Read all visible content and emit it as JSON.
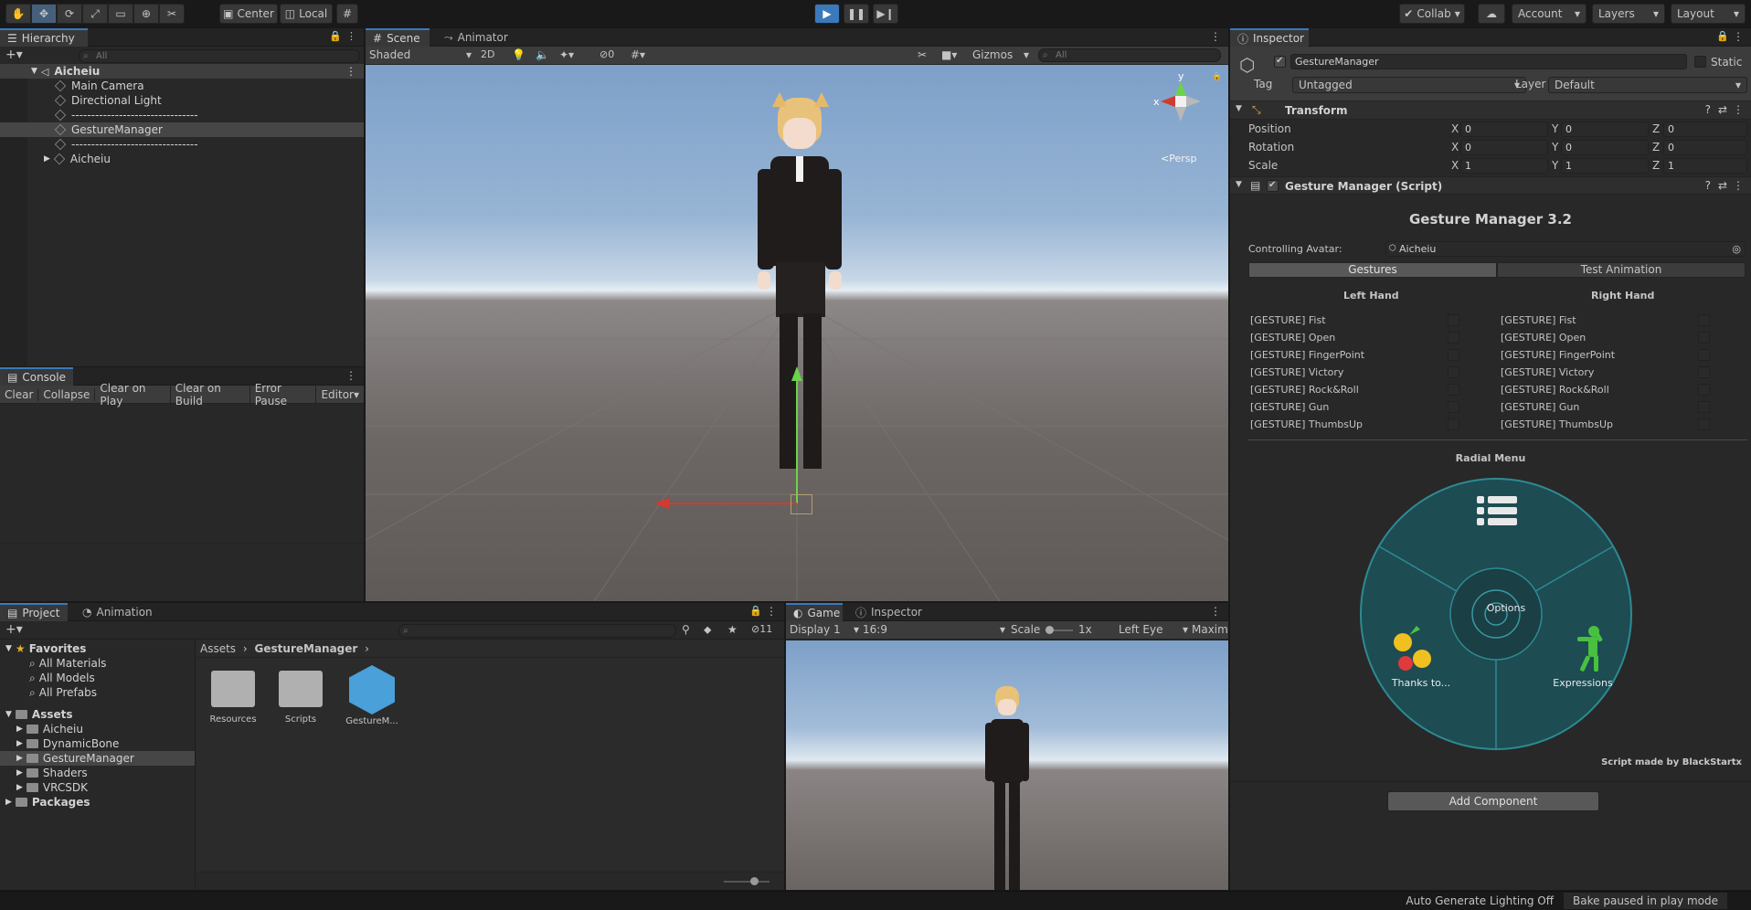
{
  "toolbar": {
    "center_label": "Center",
    "local_label": "Local",
    "collab_label": "Collab",
    "account_label": "Account",
    "layers_label": "Layers",
    "layout_label": "Layout",
    "play_accent": "#3a79bb"
  },
  "hierarchy": {
    "tab": "Hierarchy",
    "search_placeholder": "All",
    "scene": "Aicheiu",
    "items": [
      "Main Camera",
      "Directional Light",
      "--------------------------------",
      "GestureManager",
      "--------------------------------",
      "Aicheiu"
    ]
  },
  "console": {
    "tab": "Console",
    "buttons": [
      "Clear",
      "Collapse",
      "Clear on Play",
      "Clear on Build",
      "Error Pause",
      "Editor"
    ]
  },
  "scene_view": {
    "tabs": [
      "Scene",
      "Animator"
    ],
    "shading": "Shaded",
    "mode_2d": "2D",
    "hidden_count": "0",
    "gizmos": "Gizmos",
    "search_placeholder": "All",
    "persp": "Persp",
    "axis_x": "x",
    "axis_y": "y"
  },
  "project": {
    "tabs": [
      "Project",
      "Animation"
    ],
    "favorites_label": "Favorites",
    "favorites": [
      "All Materials",
      "All Models",
      "All Prefabs"
    ],
    "assets_label": "Assets",
    "asset_folders": [
      "Aicheiu",
      "DynamicBone",
      "GestureManager",
      "Shaders",
      "VRCSDK"
    ],
    "packages_label": "Packages",
    "breadcrumb_root": "Assets",
    "breadcrumb_current": "GestureManager",
    "badge_count": "11",
    "grid_items": [
      "Resources",
      "Scripts",
      "GestureM..."
    ]
  },
  "game_view": {
    "tabs": [
      "Game",
      "Inspector"
    ],
    "display": "Display 1",
    "aspect": "16:9",
    "scale_label": "Scale",
    "scale_value": "1x",
    "eye": "Left Eye",
    "maximize": "Maximi"
  },
  "inspector": {
    "tab": "Inspector",
    "object_name": "GestureManager",
    "static_label": "Static",
    "tag_label": "Tag",
    "tag_value": "Untagged",
    "layer_label": "Layer",
    "layer_value": "Default",
    "transform": {
      "title": "Transform",
      "position_label": "Position",
      "rotation_label": "Rotation",
      "scale_label": "Scale",
      "axis_x": "X",
      "axis_y": "Y",
      "axis_z": "Z",
      "position": [
        "0",
        "0",
        "0"
      ],
      "rotation": [
        "0",
        "0",
        "0"
      ],
      "scale": [
        "1",
        "1",
        "1"
      ]
    },
    "script": {
      "title": "Gesture Manager (Script)",
      "heading": "Gesture Manager 3.2",
      "controlling_label": "Controlling Avatar:",
      "controlling_value": "Aicheiu",
      "tab_gestures": "Gestures",
      "tab_test": "Test Animation",
      "left_hand": "Left Hand",
      "right_hand": "Right Hand",
      "gestures": [
        "[GESTURE] Fist",
        "[GESTURE] Open",
        "[GESTURE] FingerPoint",
        "[GESTURE] Victory",
        "[GESTURE] Rock&Roll",
        "[GESTURE] Gun",
        "[GESTURE] ThumbsUp"
      ],
      "radial_title": "Radial Menu",
      "radial_options": "Options",
      "radial_thanks": "Thanks to...",
      "radial_expressions": "Expressions",
      "credit": "Script made by BlackStartx",
      "radial_color": "#1d4c53"
    },
    "add_component": "Add Component"
  },
  "statusbar": {
    "lighting": "Auto Generate Lighting Off",
    "bake": "Bake paused in play mode"
  }
}
